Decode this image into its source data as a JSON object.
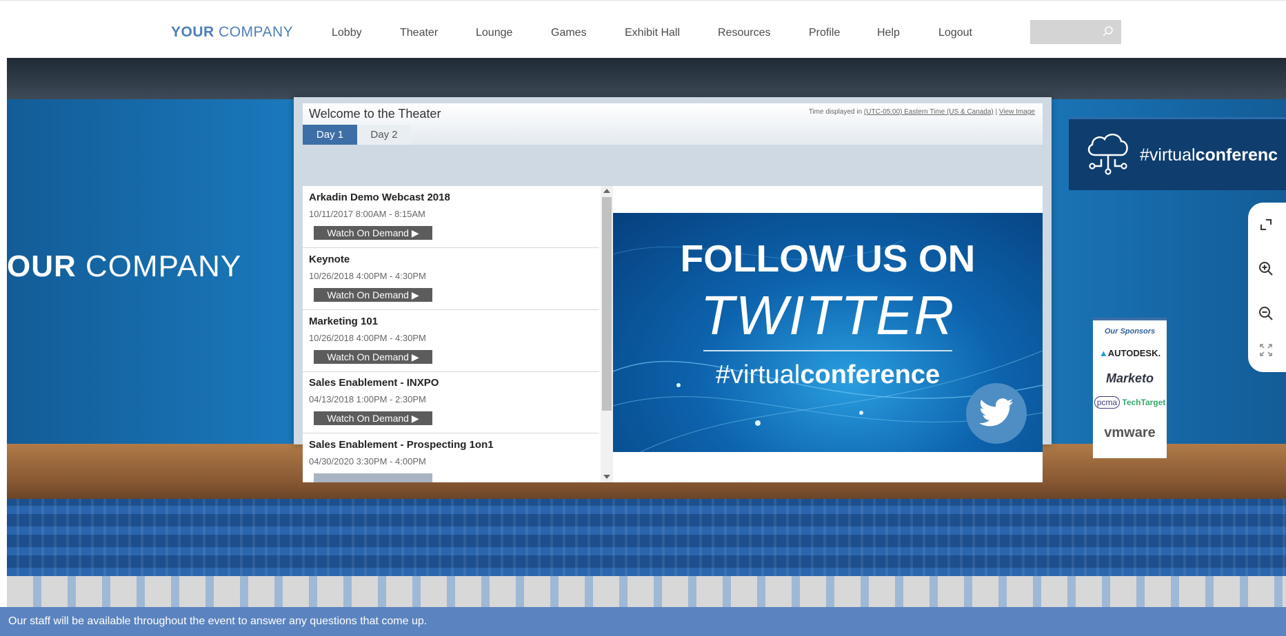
{
  "brand": {
    "bold": "YOUR",
    "light": " COMPANY"
  },
  "nav": {
    "items": [
      "Lobby",
      "Theater",
      "Lounge",
      "Games",
      "Exhibit Hall",
      "Resources",
      "Profile",
      "Help",
      "Logout"
    ]
  },
  "search": {
    "placeholder": ""
  },
  "scene": {
    "side_brand": {
      "bold": "OUR",
      "light": " COMPANY"
    }
  },
  "theater": {
    "title": "Welcome to the Theater",
    "time_note": {
      "prefix": "Time displayed in ",
      "tz_link": "(UTC-05:00) Eastern Time (US & Canada)",
      "sep": " | ",
      "view_link": "View Image"
    },
    "tabs": [
      {
        "label": "Day 1",
        "selected": true
      },
      {
        "label": "Day 2",
        "selected": false
      }
    ],
    "sessions": [
      {
        "title": "Arkadin Demo Webcast 2018",
        "time": "10/11/2017 8:00AM - 8:15AM",
        "button": "Watch On Demand ▶"
      },
      {
        "title": "Keynote",
        "time": "10/26/2018 4:00PM - 4:30PM",
        "button": "Watch On Demand ▶"
      },
      {
        "title": "Marketing 101",
        "time": "10/26/2018 4:00PM - 4:30PM",
        "button": "Watch On Demand ▶"
      },
      {
        "title": "Sales Enablement - INXPO",
        "time": "04/13/2018 1:00PM - 2:30PM",
        "button": "Watch On Demand ▶"
      },
      {
        "title": "Sales Enablement - Prospecting 1on1",
        "time": "04/30/2020 3:30PM - 4:00PM",
        "button": ""
      }
    ],
    "promo": {
      "line1": "FOLLOW US ON",
      "line2": "TWITTER",
      "hashtag_light": "#virtual",
      "hashtag_bold": "conference"
    }
  },
  "banner": {
    "light": "#virtual",
    "bold": "conferenc"
  },
  "sponsors": {
    "title": "Our Sponsors",
    "items": [
      "AUTODESK.",
      "Marketo",
      "pcma",
      "TechTarget",
      "vmware"
    ]
  },
  "info_bar": {
    "text": "Our staff will be available throughout the event to answer any questions that come up."
  },
  "colors": {
    "brand": "#4e7fb7",
    "tab_active": "#3d6fa6",
    "info_bar": "#5b83bf",
    "watch_button": "#5c5c5c",
    "banner_bg": "#0f3d6e"
  },
  "icons": [
    "search-icon",
    "cloud-network-icon",
    "fullscreen-icon",
    "zoom-in-icon",
    "zoom-out-icon",
    "fit-screen-icon",
    "twitter-icon"
  ]
}
